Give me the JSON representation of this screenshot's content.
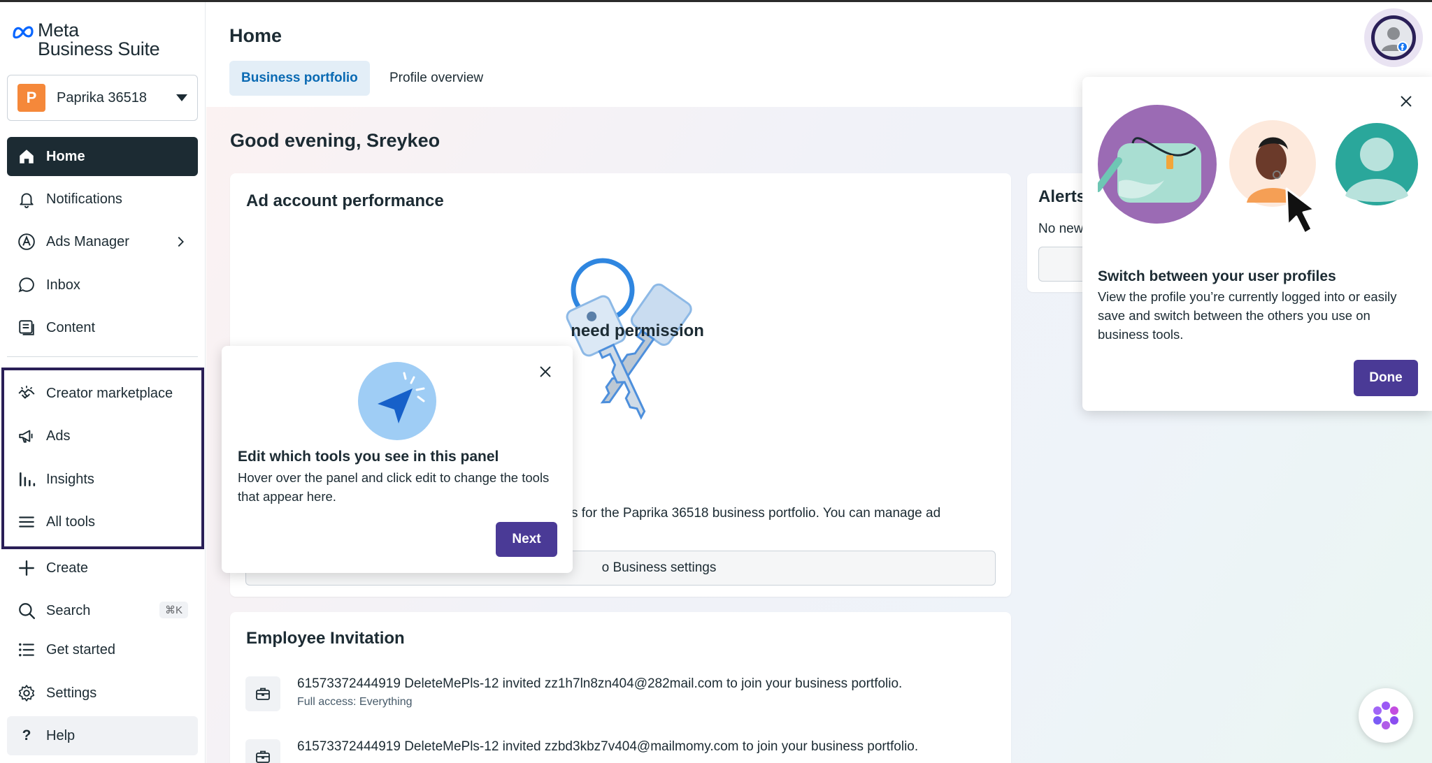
{
  "brand": {
    "line1": "Meta",
    "line2": "Business Suite"
  },
  "portfolio": {
    "initial": "P",
    "name": "Paprika 36518"
  },
  "nav": {
    "home": "Home",
    "notifications": "Notifications",
    "ads_manager": "Ads Manager",
    "inbox": "Inbox",
    "content": "Content",
    "creator_marketplace": "Creator marketplace",
    "ads": "Ads",
    "insights": "Insights",
    "all_tools": "All tools",
    "create": "Create",
    "search": "Search",
    "search_shortcut": "⌘K",
    "get_started": "Get started",
    "settings": "Settings",
    "help": "Help"
  },
  "header": {
    "title": "Home",
    "tabs": [
      "Business portfolio",
      "Profile overview"
    ]
  },
  "greeting": "Good evening, Sreykeo",
  "ad_performance": {
    "title": "Ad account performance",
    "permission_title": "need permission",
    "permission_text": "s for the Paprika 36518 business portfolio. You can manage ad",
    "settings_button": "o Business settings"
  },
  "alerts": {
    "title": "Alerts",
    "text": "No new"
  },
  "invitations": {
    "title": "Employee Invitation",
    "items": [
      {
        "text": "61573372444919 DeleteMePls-12 invited zz1h7ln8zn404@282mail.com to join your business portfolio.",
        "access": "Full access: Everything"
      },
      {
        "text": "61573372444919 DeleteMePls-12 invited zzbd3kbz7v404@mailmomy.com to join your business portfolio.",
        "access": ""
      }
    ]
  },
  "tools_popover": {
    "title": "Edit which tools you see in this panel",
    "body": "Hover over the panel and click edit to change the tools that appear here.",
    "button": "Next"
  },
  "profile_popover": {
    "title": "Switch between your user profiles",
    "body": "View the profile you’re currently logged into or easily save and switch between the others you use on business tools.",
    "button": "Done"
  },
  "colors": {
    "sidebar_active": "#1c2b33",
    "primary_button": "#4a3a96",
    "tab_active_text": "#0a6ab3",
    "portfolio_avatar": "#f5883a",
    "highlight": "#2a1f57"
  }
}
